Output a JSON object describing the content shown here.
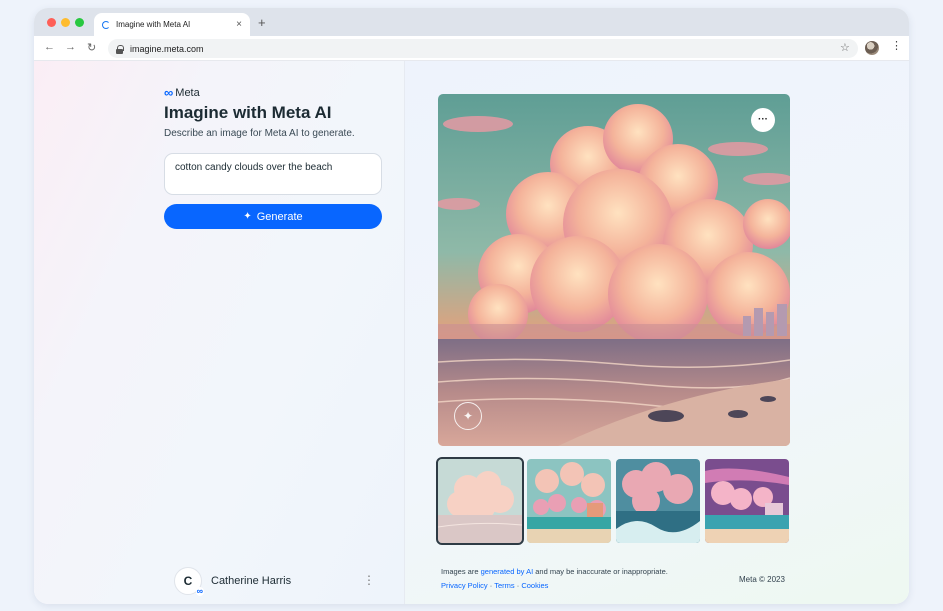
{
  "browser": {
    "tab_title": "Imagine with Meta AI",
    "tab_close": "×",
    "new_tab": "+",
    "url": "imagine.meta.com",
    "nav_back": "←",
    "nav_forward": "→",
    "nav_reload": "↻",
    "star": "☆",
    "menu": "⋮"
  },
  "left": {
    "brand": "Meta",
    "title": "Imagine with Meta AI",
    "subtitle": "Describe an image for Meta AI to generate.",
    "prompt_value": "cotton candy clouds over the beach",
    "generate_label": "Generate",
    "generate_icon": "sparkle-icon"
  },
  "user": {
    "initial": "C",
    "name": "Catherine Harris",
    "more": "⋮"
  },
  "right": {
    "more_label": "···",
    "footer_prefix": "Images are ",
    "footer_link": "generated by AI",
    "footer_suffix": " and may be inaccurate or inappropriate.",
    "links": [
      "Privacy Policy",
      "Terms",
      "Cookies"
    ],
    "separator": " · ",
    "copyright": "Meta © 2023",
    "selected_thumbnail": 1
  },
  "colors": {
    "accent": "#0866ff",
    "text_primary": "#1c2b33"
  }
}
